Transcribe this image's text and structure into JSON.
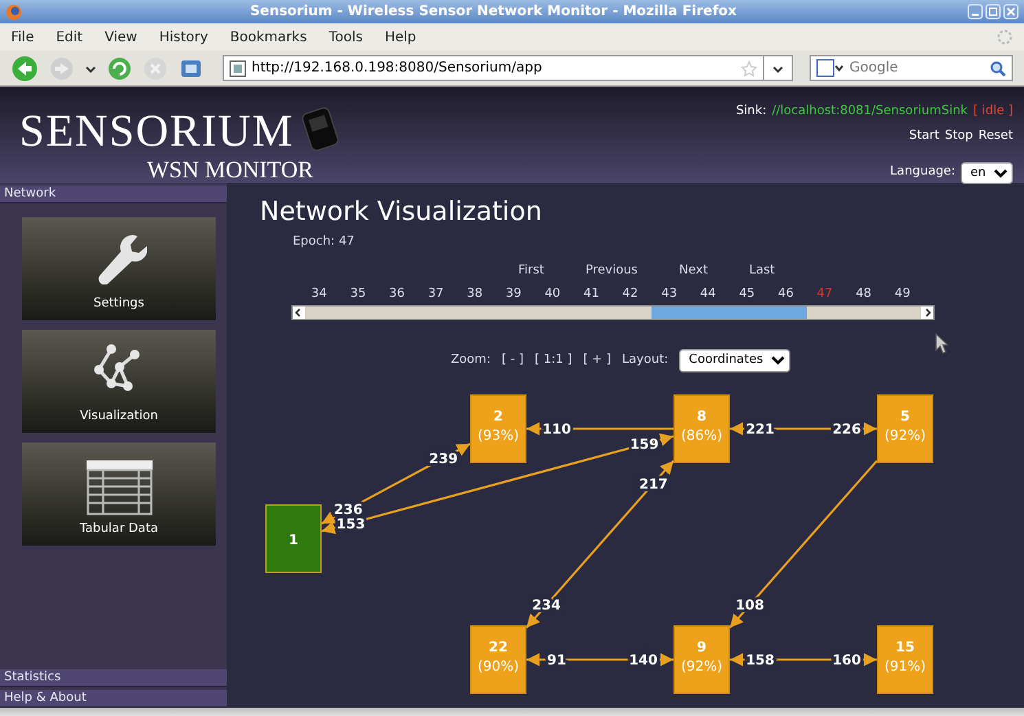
{
  "window": {
    "title": "Sensorium - Wireless Sensor Network Monitor - Mozilla Firefox"
  },
  "menu": [
    "File",
    "Edit",
    "View",
    "History",
    "Bookmarks",
    "Tools",
    "Help"
  ],
  "address_bar": {
    "url": "http://192.168.0.198:8080/Sensorium/app"
  },
  "search_bar": {
    "placeholder": "Google"
  },
  "header": {
    "logo_title": "SENSORIUM",
    "logo_subtitle": "WSN MONITOR",
    "sink_label": "Sink:",
    "sink_address": "//localhost:8081/SensoriumSink",
    "sink_status": "[ idle ]",
    "actions": [
      "Start",
      "Stop",
      "Reset"
    ],
    "language_label": "Language:",
    "language": "en"
  },
  "sidebar": {
    "sections": [
      {
        "title": "Network",
        "expanded": true,
        "tiles": [
          {
            "kind": "settings",
            "label": "Settings"
          },
          {
            "kind": "visualization",
            "label": "Visualization"
          },
          {
            "kind": "table",
            "label": "Tabular Data"
          }
        ]
      },
      {
        "title": "Statistics",
        "expanded": false
      },
      {
        "title": "Help & About",
        "expanded": false
      }
    ]
  },
  "main": {
    "title": "Network Visualization",
    "epoch_label": "Epoch: 47",
    "nav": [
      "First",
      "Previous",
      "Next",
      "Last"
    ],
    "epochs": [
      {
        "label": "34",
        "current": false,
        "in_view": false
      },
      {
        "label": "35",
        "current": false,
        "in_view": false
      },
      {
        "label": "36",
        "current": false,
        "in_view": false
      },
      {
        "label": "37",
        "current": false,
        "in_view": false
      },
      {
        "label": "38",
        "current": false,
        "in_view": false
      },
      {
        "label": "39",
        "current": false,
        "in_view": false
      },
      {
        "label": "40",
        "current": false,
        "in_view": false
      },
      {
        "label": "41",
        "current": false,
        "in_view": false
      },
      {
        "label": "42",
        "current": false,
        "in_view": false
      },
      {
        "label": "43",
        "current": false,
        "in_view": true
      },
      {
        "label": "44",
        "current": false,
        "in_view": true
      },
      {
        "label": "45",
        "current": false,
        "in_view": true
      },
      {
        "label": "46",
        "current": false,
        "in_view": true
      },
      {
        "label": "47",
        "current": true,
        "in_view": false
      },
      {
        "label": "48",
        "current": false,
        "in_view": false
      },
      {
        "label": "49",
        "current": false,
        "in_view": false
      }
    ],
    "zoom_label": "Zoom:",
    "zoom_buttons": [
      "[ - ]",
      "[ 1:1 ]",
      "[ + ]"
    ],
    "layout_label": "Layout:",
    "layout": "Coordinates",
    "graph": {
      "nodes": [
        {
          "kind": "sink",
          "label": "1"
        },
        {
          "kind": "sensor",
          "label": "2",
          "battery": "(93%)"
        },
        {
          "kind": "sensor",
          "label": "8",
          "battery": "(86%)"
        },
        {
          "kind": "sensor",
          "label": "5",
          "battery": "(92%)"
        },
        {
          "kind": "sensor",
          "label": "22",
          "battery": "(90%)"
        },
        {
          "kind": "sensor",
          "label": "9",
          "battery": "(92%)"
        },
        {
          "kind": "sensor",
          "label": "15",
          "battery": "(91%)"
        }
      ],
      "edges": [
        {
          "label_start": "236",
          "label_end": "239"
        },
        {
          "label_start": "153",
          "label_end": "159"
        },
        {
          "label_start": "110"
        },
        {
          "label_start": "221",
          "label_end": "226"
        },
        {
          "label_start": "217",
          "label_end": "234"
        },
        {
          "label_end": "108"
        },
        {
          "label_start": "91",
          "label_end": "140"
        },
        {
          "label_start": "158",
          "label_end": "160"
        }
      ]
    }
  }
}
